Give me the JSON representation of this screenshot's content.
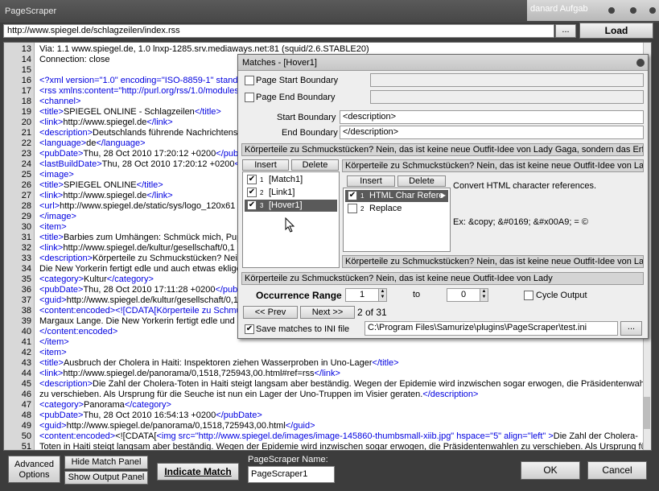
{
  "window": {
    "title": "PageScraper",
    "background_app_title": "danard Aufgab"
  },
  "urlbar": {
    "url": "http://www.spiegel.de/schlagzeilen/index.rss",
    "browse_label": "...",
    "load_label": "Load"
  },
  "source": {
    "line_numbers": [
      "13",
      "14",
      "15",
      "16",
      "17",
      "18",
      "19",
      "20",
      "21",
      "22",
      "23",
      "24",
      "25",
      "26",
      "27",
      "28",
      "29",
      "30",
      "31",
      "32",
      "33",
      "34",
      "35",
      "36",
      "37",
      "38",
      "39",
      "40",
      "41",
      "42",
      "43",
      "44",
      "45",
      "46",
      "47",
      "48",
      "49",
      "50",
      "51"
    ],
    "lines": [
      "Via: 1.1 www.spiegel.de, 1.0 lnxp-1285.srv.mediaways.net:81 (squid/2.6.STABLE20)",
      "Connection: close",
      "",
      "<?xml version=\"1.0\" encoding=\"ISO-8859-1\" standa",
      "<rss xmlns:content=\"http://purl.org/rss/1.0/modules",
      "<channel>",
      "<title>SPIEGEL ONLINE - Schlagzeilen</title>",
      "<link>http://www.spiegel.de</link>",
      "<description>Deutschlands führende Nachrichtense",
      "<language>de</language>",
      "<pubDate>Thu, 28 Oct 2010 17:20:12 +0200</pubDat",
      "<lastBuildDate>Thu, 28 Oct 2010 17:20:12 +0200</",
      "<image>",
      "<title>SPIEGEL ONLINE</title>",
      "<link>http://www.spiegel.de</link>",
      "<url>http://www.spiegel.de/static/sys/logo_120x61",
      "</image>",
      "<item>",
      "<title>Barbies zum Umhängen: Schmück mich, Pupp",
      "<link>http://www.spiegel.de/kultur/gesellschaft/0,1",
      "<description>Körperteile zu Schmuckstücken? Nein,",
      "Die New Yorkerin fertigt edle und auch etwas eklige",
      "<category>Kultur</category>",
      "<pubDate>Thu, 28 Oct 2010 17:11:28 +0200</pubDat",
      "<guid>http://www.spiegel.de/kultur/gesellschaft/0,1",
      "<content:encoded><![CDATA[Körperteile zu Schmuc",
      "Margaux Lange. Die New Yorkerin fertigt edle und a",
      "</content:encoded>",
      "</item>",
      "<item>",
      "<title>Ausbruch der Cholera in Haiti: Inspektoren ziehen Wasserproben in Uno-Lager</title>",
      "<link>http://www.spiegel.de/panorama/0,1518,725943,00.html#ref=rss</link>",
      "<description>Die Zahl der Cholera-Toten in Haiti steigt langsam aber beständig. Wegen der Epidemie wird inzwischen sogar erwogen, die Präsidentenwahlen",
      "zu verschieben. Als Ursprung für die Seuche ist nun ein Lager der Uno-Truppen im Visier geraten.</description>",
      "<category>Panorama</category>",
      "<pubDate>Thu, 28 Oct 2010 16:54:13 +0200</pubDate>",
      "<guid>http://www.spiegel.de/panorama/0,1518,725943,00.html</guid>",
      "<content:encoded><![CDATA[<img src=\"http://www.spiegel.de/images/image-145860-thumbsmall-xiib.jpg\" hspace=\"5\" align=\"left\" >Die Zahl der Cholera-",
      "Toten in Haiti steigt langsam aber beständig. Wegen der Epidemie wird inzwischen sogar erwogen, die Präsidentenwahlen zu verschieben. Als Ursprung für die"
    ]
  },
  "dialog": {
    "title": "Matches - [Hover1]",
    "page_start_label": "Page Start Boundary",
    "page_end_label": "Page End Boundary",
    "start_boundary_label": "Start Boundary",
    "start_boundary_value": "<description>",
    "end_boundary_label": "End Boundary",
    "end_boundary_value": "</description>",
    "preview_text": "Körperteile zu Schmuckstücken? Nein, das ist keine neue Outfit-Idee von Lady Gaga, sondern das Erfolg",
    "preview_text_short": "Körperteile zu Schmuckstücken? Nein, das ist keine neue Outfit-Idee von Lady",
    "insert_label": "Insert",
    "delete_label": "Delete",
    "matches": [
      {
        "num": "1",
        "label": "[Match1]",
        "checked": true
      },
      {
        "num": "2",
        "label": "[Link1]",
        "checked": true
      },
      {
        "num": "3",
        "label": "[Hover1]",
        "checked": true
      }
    ],
    "filters": [
      {
        "num": "1",
        "label": "HTML Char Refere",
        "checked": true
      },
      {
        "num": "2",
        "label": "Replace",
        "checked": false
      }
    ],
    "filter_desc": "Convert HTML character references.",
    "filter_example": "Ex: &copy; &#0169; &#x00A9; = ©",
    "occurrence_label": "Occurrence Range",
    "occ_from": "1",
    "occ_to_label": "to",
    "occ_to": "0",
    "cycle_label": "Cycle Output",
    "prev_label": "<< Prev",
    "next_label": "Next >>",
    "position_text": "2 of 31",
    "save_label": "Save matches to INI file",
    "ini_path": "C:\\Program Files\\Samurize\\plugins\\PageScraper\\test.ini",
    "ini_browse": "..."
  },
  "bottom": {
    "advanced_label": "Advanced Options",
    "hide_match_label": "Hide Match Panel",
    "show_output_label": "Show Output Panel",
    "indicate_label": "Indicate Match",
    "name_label": "PageScraper Name:",
    "name_value": "PageScraper1",
    "ok_label": "OK",
    "cancel_label": "Cancel"
  }
}
